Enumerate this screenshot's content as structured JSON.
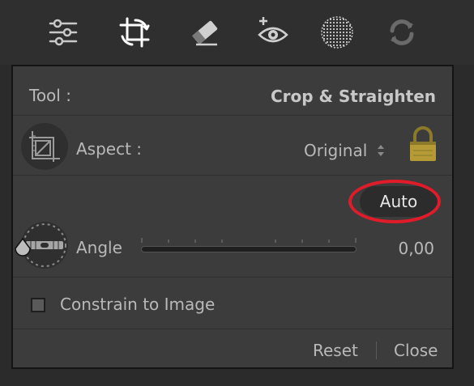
{
  "toolbar": {
    "items": [
      {
        "icon": "sliders-icon",
        "label": ""
      },
      {
        "icon": "crop-rotate-icon",
        "label": ""
      },
      {
        "icon": "eraser-icon",
        "label": ""
      },
      {
        "icon": "red-eye-icon",
        "label": ""
      },
      {
        "icon": "radial-mask-icon",
        "label": ""
      },
      {
        "icon": "sync-icon",
        "label": ""
      }
    ],
    "active": "crop-rotate-icon"
  },
  "panel": {
    "tool_label": "Tool :",
    "tool_value": "Crop & Straighten",
    "aspect": {
      "label": "Aspect :",
      "value": "Original",
      "options_icon": "up-down-chevron-icon",
      "lock_icon": "lock-icon",
      "locked": true
    },
    "auto_button": "Auto",
    "angle": {
      "label": "Angle",
      "value": "0,00",
      "slider_fraction": 0.5
    },
    "constrain_label": "Constrain to Image",
    "constrain_checked": false,
    "reset_label": "Reset",
    "close_label": "Close"
  },
  "colors": {
    "highlight_ring": "#e01b2a",
    "lock_gold": "#b59a35"
  }
}
